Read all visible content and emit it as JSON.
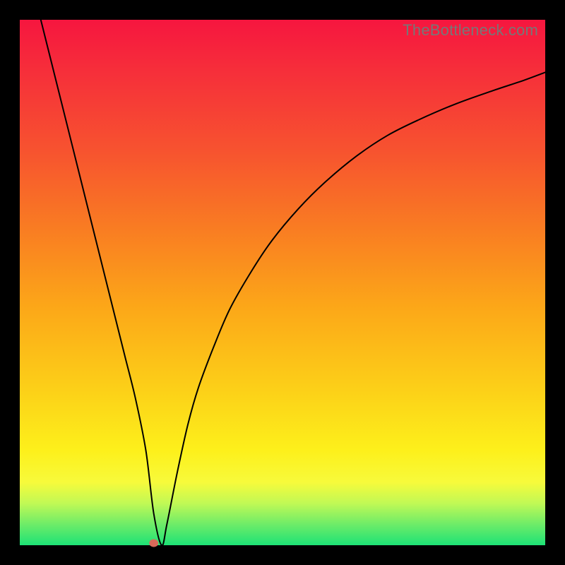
{
  "watermark": "TheBottleneck.com",
  "colors": {
    "frame": "#000000",
    "gradient_top": "#f6163f",
    "gradient_bottom": "#1de276",
    "curve": "#000000",
    "marker": "#d96a5a"
  },
  "chart_data": {
    "type": "line",
    "title": "",
    "xlabel": "",
    "ylabel": "",
    "xlim": [
      0,
      100
    ],
    "ylim": [
      0,
      100
    ],
    "series": [
      {
        "name": "curve",
        "x": [
          4,
          6,
          8,
          10,
          12,
          14,
          16,
          18,
          20,
          22,
          24,
          25.5,
          27,
          28,
          30,
          32,
          34,
          37,
          40,
          44,
          48,
          53,
          58,
          64,
          70,
          76,
          83,
          90,
          96,
          100
        ],
        "values": [
          100,
          92,
          84,
          76,
          68,
          60,
          52,
          44,
          36,
          28,
          18,
          6,
          0,
          4,
          14,
          23,
          30,
          38,
          45,
          52,
          58,
          64,
          69,
          74,
          78,
          81,
          84,
          86.5,
          88.5,
          90
        ]
      }
    ],
    "marker": {
      "x": 25.5,
      "y": 0
    },
    "grid": false,
    "legend": false
  }
}
